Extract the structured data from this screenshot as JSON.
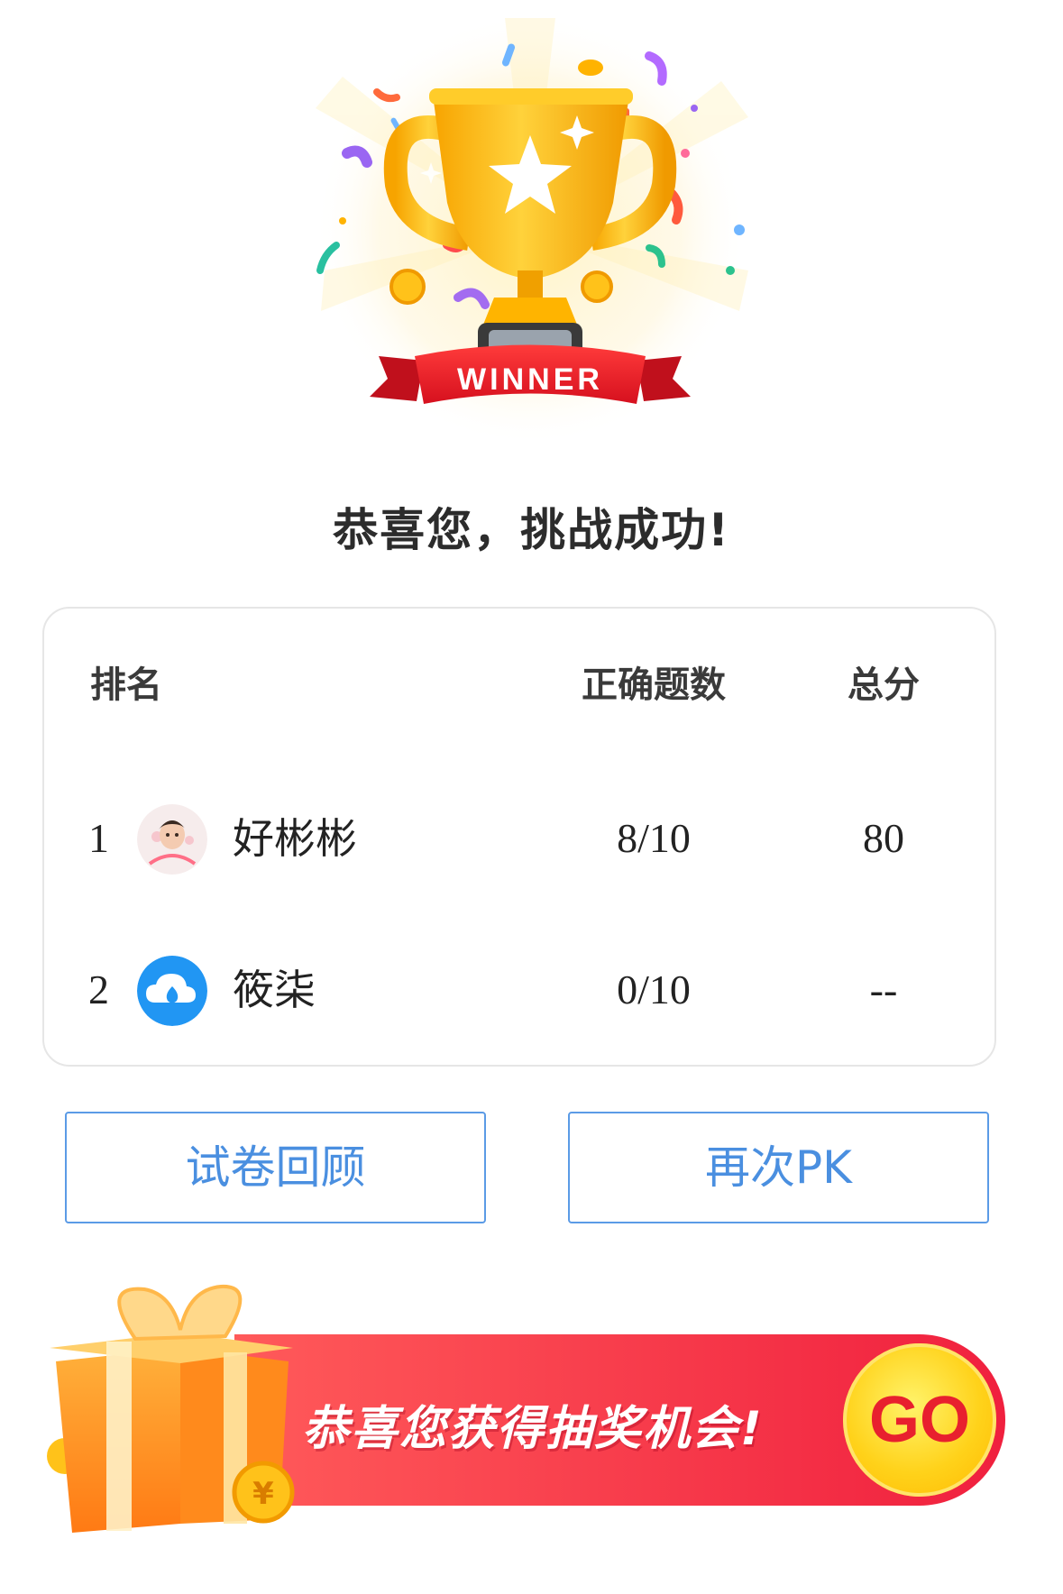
{
  "hero": {
    "badge_text": "WINNER"
  },
  "headline": "恭喜您，挑战成功!",
  "table": {
    "headers": {
      "rank": "排名",
      "correct": "正确题数",
      "score": "总分"
    },
    "rows": [
      {
        "rank": "1",
        "name": "好彬彬",
        "correct": "8/10",
        "score": "80",
        "avatar": "user-photo-avatar"
      },
      {
        "rank": "2",
        "name": "筱柒",
        "correct": "0/10",
        "score": "--",
        "avatar": "cloud-avatar"
      }
    ]
  },
  "buttons": {
    "review": "试卷回顾",
    "again": "再次PK"
  },
  "banner": {
    "text": "恭喜您获得抽奖机会!",
    "go": "GO",
    "coin_symbol": "¥"
  },
  "colors": {
    "accent_blue": "#4a8fe0",
    "banner_red": "#f2374f",
    "go_yellow": "#ffd21a",
    "ribbon_red": "#e8202e"
  }
}
